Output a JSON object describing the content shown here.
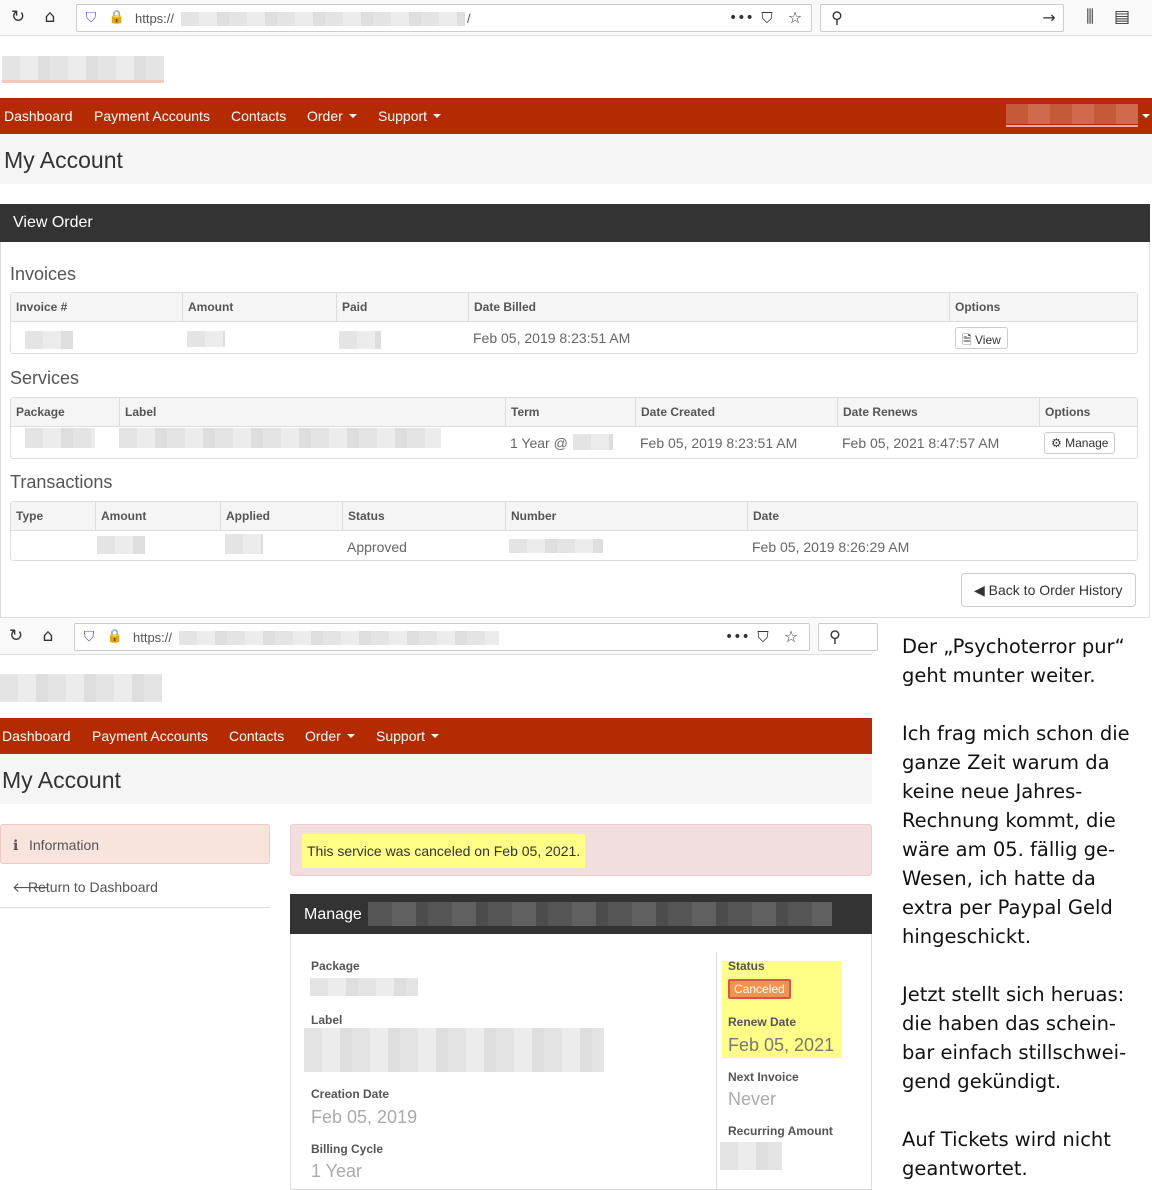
{
  "screen1": {
    "url_prefix": "https://",
    "url_suffix": "/",
    "nav": [
      "Dashboard",
      "Payment Accounts",
      "Contacts",
      "Order",
      "Support"
    ],
    "page_title": "My Account",
    "panel_title": "View Order",
    "invoices": {
      "title": "Invoices",
      "headers": [
        "Invoice #",
        "Amount",
        "Paid",
        "Date Billed",
        "Options"
      ],
      "row": {
        "date_billed": "Feb 05, 2019 8:23:51 AM",
        "option": "View"
      }
    },
    "services": {
      "title": "Services",
      "headers": [
        "Package",
        "Label",
        "Term",
        "Date Created",
        "Date Renews",
        "Options"
      ],
      "row": {
        "term": "1 Year @",
        "date_created": "Feb 05, 2019 8:23:51 AM",
        "date_renews": "Feb 05, 2021 8:47:57 AM",
        "option": "Manage"
      }
    },
    "transactions": {
      "title": "Transactions",
      "headers": [
        "Type",
        "Amount",
        "Applied",
        "Status",
        "Number",
        "Date"
      ],
      "row": {
        "status": "Approved",
        "date": "Feb 05, 2019 8:26:29 AM"
      }
    },
    "back_button": "Back to Order History"
  },
  "screen2": {
    "url_prefix": "https://",
    "nav": [
      "Dashboard",
      "Payment Accounts",
      "Contacts",
      "Order",
      "Support"
    ],
    "page_title": "My Account",
    "sidebar": [
      "Information",
      "Return to Dashboard"
    ],
    "alert": "This service was canceled on Feb 05, 2021.",
    "manage_title": "Manage",
    "fields": {
      "package": "Package",
      "label": "Label",
      "creation_date_label": "Creation Date",
      "creation_date": "Feb 05, 2019",
      "billing_cycle_label": "Billing Cycle",
      "billing_cycle": "1 Year",
      "status_label": "Status",
      "status": "Canceled",
      "renew_date_label": "Renew Date",
      "renew_date": "Feb 05, 2021",
      "next_invoice_label": "Next Invoice",
      "next_invoice": "Never",
      "recurring_amount_label": "Recurring Amount"
    }
  },
  "note": [
    "Der „Psychoterror pur“ geht munter weiter.",
    "Ich frag mich schon die ganze Zeit warum da keine neue Jahres-Rechnung kommt, die wäre am 05. fällig ge-Wesen, ich hatte da extra per Paypal Geld hingeschickt.",
    "Jetzt stellt sich heruas: die haben das schein-bar einfach stillschwei-gend gekündigt.",
    "Auf Tickets wird nicht geantwortet."
  ],
  "colors": {
    "nav": "#b42b03",
    "panel_dark": "#333333",
    "highlight": "#ffff88",
    "alert_bg": "#f2dede"
  }
}
